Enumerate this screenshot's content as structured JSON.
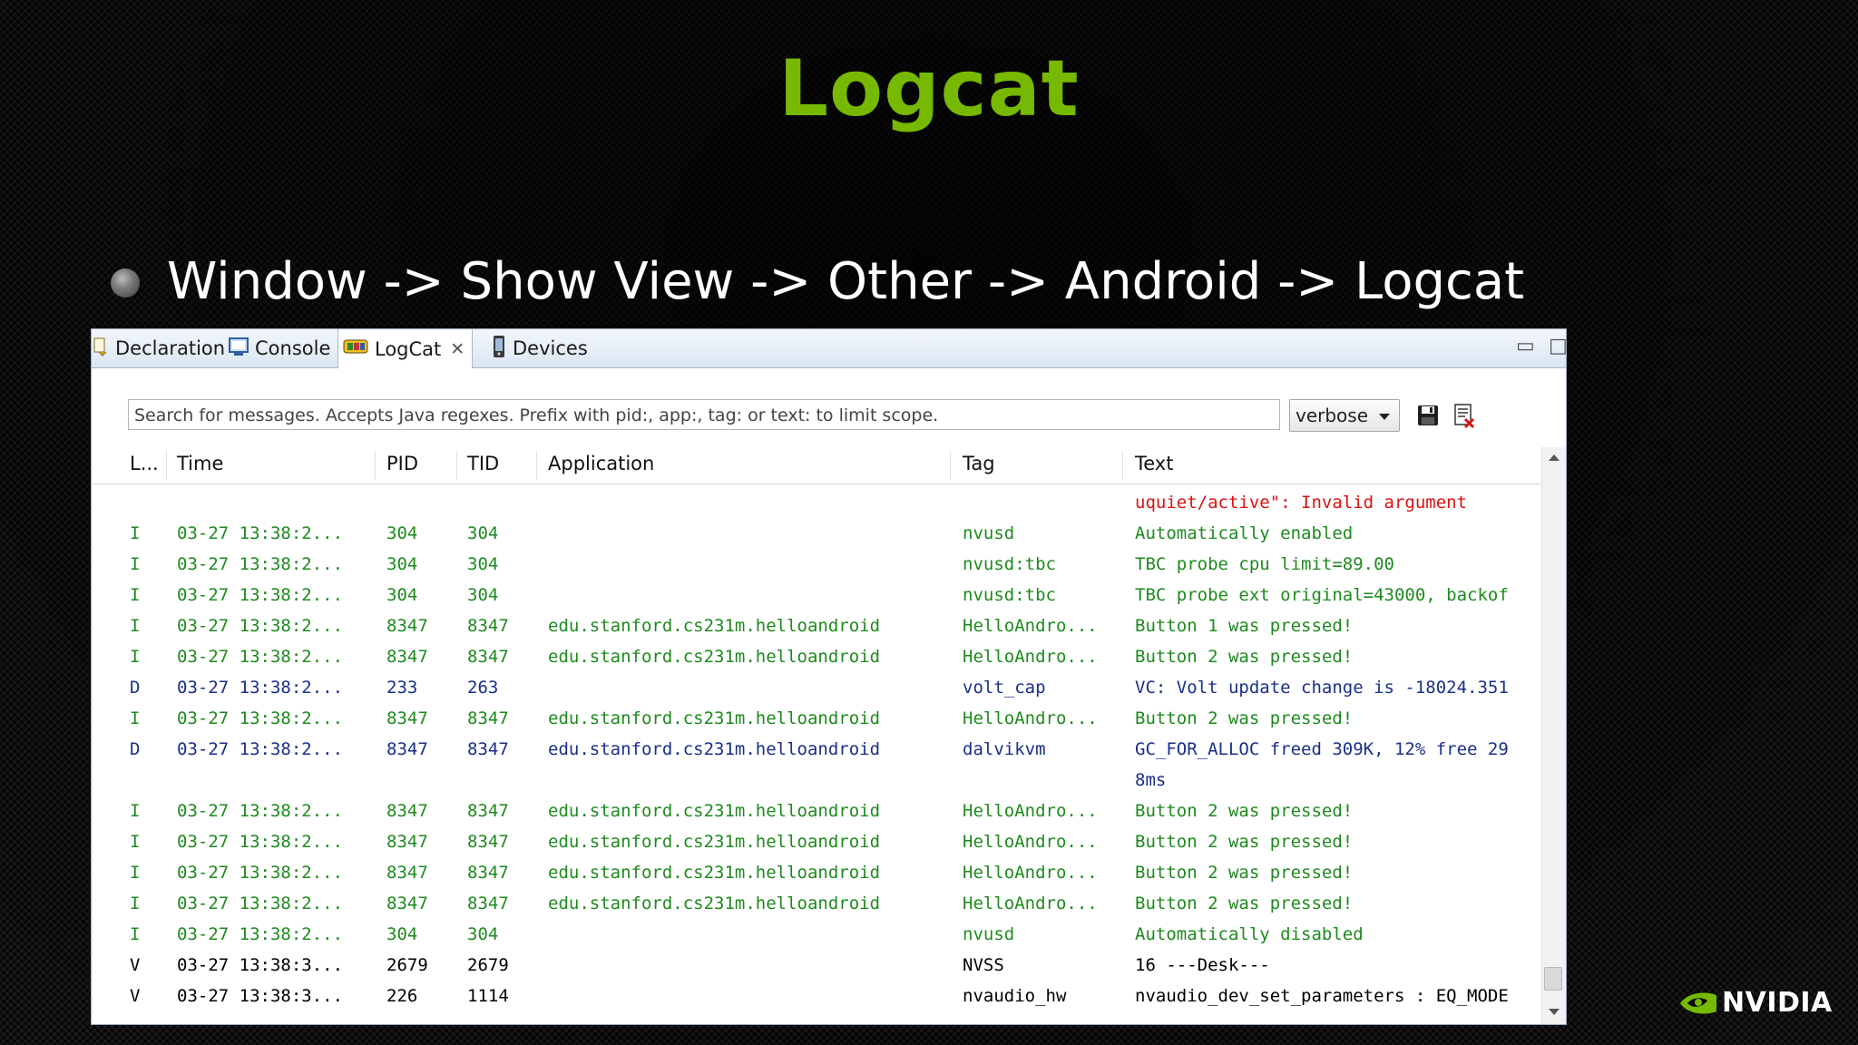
{
  "slide": {
    "title": "Logcat",
    "bullet": "Window -> Show View -> Other -> Android -> Logcat",
    "brand": "NVIDIA"
  },
  "colors": {
    "title_green": "#76b900",
    "level_info": "#1e8a1e",
    "level_debug": "#1a2f8a",
    "level_verbose": "#000000",
    "level_error": "#dd1111"
  },
  "tabs": [
    {
      "label": "Declaration",
      "icon": "declaration-icon"
    },
    {
      "label": "Console",
      "icon": "console-icon"
    },
    {
      "label": "LogCat",
      "icon": "logcat-icon",
      "active": true
    },
    {
      "label": "Devices",
      "icon": "device-phone-icon"
    }
  ],
  "toolbar": {
    "search_placeholder": "Search for messages. Accepts Java regexes. Prefix with pid:, app:, tag: or text: to limit scope.",
    "level_value": "verbose",
    "icons": [
      "save-icon",
      "clear-log-icon",
      "toggle-panel-icon",
      "scroll-lock-icon"
    ]
  },
  "columns": {
    "level": "L...",
    "time": "Time",
    "pid": "PID",
    "tid": "TID",
    "application": "Application",
    "tag": "Tag",
    "text": "Text"
  },
  "log_rows": [
    {
      "level": "",
      "time": "",
      "pid": "",
      "tid": "",
      "app": "",
      "tag": "",
      "text": "uquiet/active\": Invalid argument",
      "cls": "E"
    },
    {
      "level": "I",
      "time": "03-27 13:38:2...",
      "pid": "304",
      "tid": "304",
      "app": "",
      "tag": "nvusd",
      "text": "Automatically enabled",
      "cls": "I"
    },
    {
      "level": "I",
      "time": "03-27 13:38:2...",
      "pid": "304",
      "tid": "304",
      "app": "",
      "tag": "nvusd:tbc",
      "text": "TBC probe cpu limit=89.00",
      "cls": "I"
    },
    {
      "level": "I",
      "time": "03-27 13:38:2...",
      "pid": "304",
      "tid": "304",
      "app": "",
      "tag": "nvusd:tbc",
      "text": "TBC probe ext original=43000, backof",
      "cls": "I"
    },
    {
      "level": "I",
      "time": "03-27 13:38:2...",
      "pid": "8347",
      "tid": "8347",
      "app": "edu.stanford.cs231m.helloandroid",
      "tag": "HelloAndro...",
      "text": "Button 1 was pressed!",
      "cls": "I"
    },
    {
      "level": "I",
      "time": "03-27 13:38:2...",
      "pid": "8347",
      "tid": "8347",
      "app": "edu.stanford.cs231m.helloandroid",
      "tag": "HelloAndro...",
      "text": "Button 2 was pressed!",
      "cls": "I"
    },
    {
      "level": "D",
      "time": "03-27 13:38:2...",
      "pid": "233",
      "tid": "263",
      "app": "",
      "tag": "volt_cap",
      "text": "VC: Volt update change is -18024.351",
      "cls": "D"
    },
    {
      "level": "I",
      "time": "03-27 13:38:2...",
      "pid": "8347",
      "tid": "8347",
      "app": "edu.stanford.cs231m.helloandroid",
      "tag": "HelloAndro...",
      "text": "Button 2 was pressed!",
      "cls": "I"
    },
    {
      "level": "D",
      "time": "03-27 13:38:2...",
      "pid": "8347",
      "tid": "8347",
      "app": "edu.stanford.cs231m.helloandroid",
      "tag": "dalvikvm",
      "text": "GC_FOR_ALLOC freed 309K, 12% free 29",
      "cls": "D"
    },
    {
      "level": "",
      "time": "",
      "pid": "",
      "tid": "",
      "app": "",
      "tag": "",
      "text": "8ms",
      "cls": "D"
    },
    {
      "level": "I",
      "time": "03-27 13:38:2...",
      "pid": "8347",
      "tid": "8347",
      "app": "edu.stanford.cs231m.helloandroid",
      "tag": "HelloAndro...",
      "text": "Button 2 was pressed!",
      "cls": "I"
    },
    {
      "level": "I",
      "time": "03-27 13:38:2...",
      "pid": "8347",
      "tid": "8347",
      "app": "edu.stanford.cs231m.helloandroid",
      "tag": "HelloAndro...",
      "text": "Button 2 was pressed!",
      "cls": "I"
    },
    {
      "level": "I",
      "time": "03-27 13:38:2...",
      "pid": "8347",
      "tid": "8347",
      "app": "edu.stanford.cs231m.helloandroid",
      "tag": "HelloAndro...",
      "text": "Button 2 was pressed!",
      "cls": "I"
    },
    {
      "level": "I",
      "time": "03-27 13:38:2...",
      "pid": "8347",
      "tid": "8347",
      "app": "edu.stanford.cs231m.helloandroid",
      "tag": "HelloAndro...",
      "text": "Button 2 was pressed!",
      "cls": "I"
    },
    {
      "level": "I",
      "time": "03-27 13:38:2...",
      "pid": "304",
      "tid": "304",
      "app": "",
      "tag": "nvusd",
      "text": "Automatically disabled",
      "cls": "I"
    },
    {
      "level": "V",
      "time": "03-27 13:38:3...",
      "pid": "2679",
      "tid": "2679",
      "app": "",
      "tag": "NVSS",
      "text": "16 ---Desk---",
      "cls": "V"
    },
    {
      "level": "V",
      "time": "03-27 13:38:3...",
      "pid": "226",
      "tid": "1114",
      "app": "",
      "tag": "nvaudio_hw",
      "text": "nvaudio_dev_set_parameters : EQ_MODE",
      "cls": "V"
    }
  ]
}
